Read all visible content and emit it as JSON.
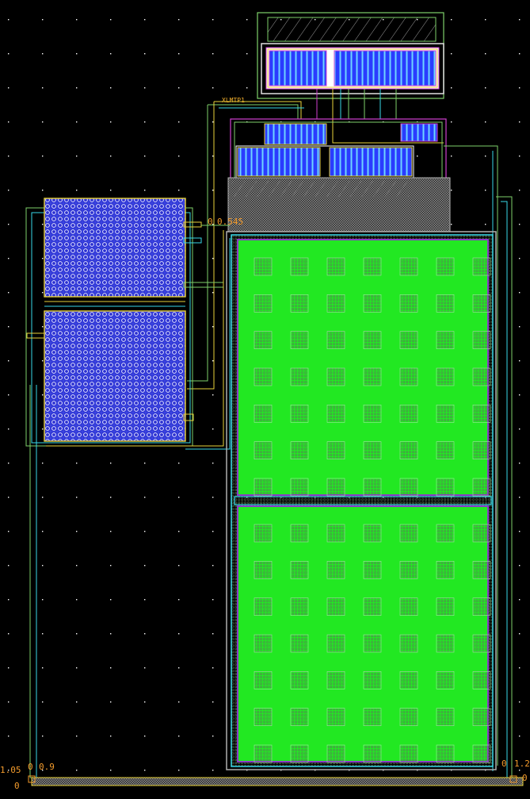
{
  "layout_view": {
    "background": "#000000",
    "grid_dot_color": "#ffffff",
    "colors": {
      "capacitor_fill": "#22e822",
      "capacitor_border": "#8a3cc8",
      "metal_blue": "#2a3cff",
      "metal_cyan": "#38d8e8",
      "poly_yellow": "#e8d23a",
      "outline_green": "#7ed06a",
      "outline_magenta": "#d040d0",
      "label_orange": "#f39b2c",
      "hatch_gray": "#b0b0b0",
      "array_white": "#e6e6ff"
    },
    "labels": {
      "net_label_top": "XLMTP1",
      "net_value_mid_a": "0",
      "net_value_mid_b": "0.545",
      "bottom_left_a": "1.05",
      "bottom_left_b": "0",
      "bottom_left_c": "0",
      "bottom_left_d": "0.9",
      "bottom_right_a": "0",
      "bottom_right_b": "1.2",
      "bottom_right_c": "0"
    }
  }
}
